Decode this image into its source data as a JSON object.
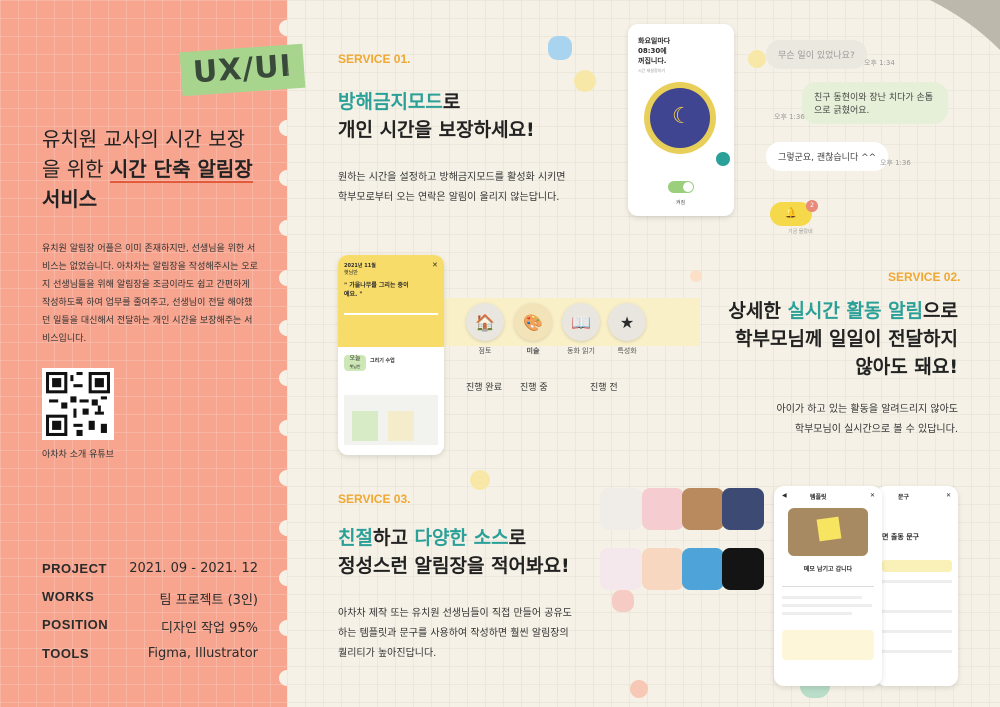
{
  "left": {
    "tag": "UX/UI",
    "title_line1": "유치원 교사의 시간 보장",
    "title_line2_pre": "을 위한 ",
    "title_line2_bold": "시간 단축 알림장",
    "title_line3": "서비스",
    "description": "유치원 알림장 어플은 이미 존재하지만, 선생님을 위한 서비스는 없었습니다. 아차차는 알림장을 작성해주시는 오로지 선생님들을 위해 알림장을 조금이라도 쉽고 간편하게 작성하도록 하여 업무를 줄여주고, 선생님이 전달 해야했던 일들을 대신해서 전달하는 개인 시간을 보장해주는 서비스입니다.",
    "qr_label": "아차차 소개 유튜브",
    "meta": [
      {
        "key": "PROJECT",
        "value": "2021. 09 - 2021. 12"
      },
      {
        "key": "WORKS",
        "value": "팀 프로젝트 (3인)"
      },
      {
        "key": "POSITION",
        "value": "디자인 작업 95%"
      },
      {
        "key": "TOOLS",
        "value": "Figma, Illustrator"
      }
    ]
  },
  "service1": {
    "label": "SERVICE 01.",
    "heading_green": "방해금지모드",
    "heading_rest1": "로",
    "heading_line2": "개인 시간을 보장하세요!",
    "body_line1": "원하는 시간을 설정하고 방해금지모드를 활성화 시키면",
    "body_line2": "학부모로부터 오는 연락은 알림이 울리지 않는답니다.",
    "phone_text1": "화요일마다",
    "phone_text2": "08:30에",
    "phone_text3": "꺼집니다.",
    "phone_sub": "시간 재설정하기",
    "phone_toggle_label": "켜짐"
  },
  "chat": {
    "msg1": "무슨 일이 있었나요?",
    "time1": "오후 1:34",
    "msg2": "친구 동현이와 장난 치다가 손톱으로 긁혔어요.",
    "time2": "오후 1:36",
    "msg3": "그렇군요, 괜찮습니다 ^^",
    "time3": "오후 1:36",
    "badge": "2",
    "footer": "기금 몰랐네"
  },
  "service2": {
    "label": "SERVICE 02.",
    "heading_pre": "상세한 ",
    "heading_green": "실시간 활동 알림",
    "heading_rest": "으로",
    "heading_line2": "학부모님께 일일이 전달하지",
    "heading_line3": "않아도 돼요!",
    "body_line1": "아이가 하고 있는 활동을 알려드리지 않아도",
    "body_line2": "학부모님이 실시간으로 볼 수 있답니다.",
    "steps": [
      "점토",
      "미술",
      "동화 읽기",
      "특성화"
    ],
    "stages": [
      "진행 완료",
      "진행 중",
      "진행 전"
    ],
    "phone_date": "2021년 11월",
    "phone_class": "햇님반",
    "phone_quote": "\" 가을나무를 그리는 중이에요. \"",
    "phone_today": "오늘",
    "phone_today_sub": "햇님반",
    "phone_section": "그리기 수업"
  },
  "service3": {
    "label": "SERVICE 03.",
    "heading_green1": "친절",
    "heading_mid": "하고 ",
    "heading_green2": "다양한 소스",
    "heading_rest": "로",
    "heading_line2": "정성스런 알림장을 적어봐요!",
    "body_line1": "아차차 제작 또는 유치원 선생님들이 직접 만들어 공유도",
    "body_line2": "하는 템플릿과 문구를 사용하여 작성하면 훨씬 알림장의",
    "body_line3": "퀄리티가 높아진답니다.",
    "template_title": "템플릿",
    "phrase_title": "문구",
    "template_card": "메모 남기고 갑니다",
    "phrase_heading": "면 출동 문구"
  },
  "colors": {
    "left_bg": "#f7a58f",
    "accent_green": "#2aa098",
    "label_orange": "#f0a832",
    "tag_green": "#a8d58e"
  }
}
